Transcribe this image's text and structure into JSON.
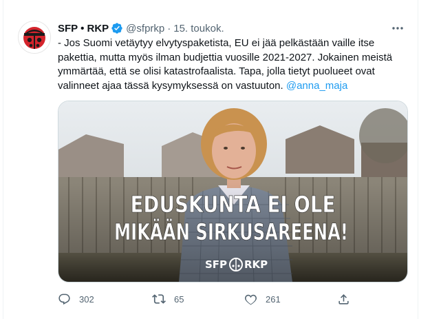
{
  "tweet": {
    "author_name": "SFP • RKP",
    "handle": "@sfprkp",
    "separator": "·",
    "date": "15. toukok.",
    "avatar_icon": "ladybug-logo-icon",
    "verified_icon": "verified-badge-icon",
    "more_icon": "more-dots-icon",
    "text_body": "- Jos Suomi vetäytyy elvytyspaketista, EU ei jää pelkästään vaille itse pakettia, mutta myös ilman budjettia vuosille 2021-2027. Jokainen meistä ymmärtää, että se olisi katastrofaalista. Tapa, jolla tietyt puolueet ovat valinneet ajaa tässä kysymyksessä on vastuuton.",
    "mention": "@anna_maja",
    "media": {
      "headline_line1": "EDUSKUNTA EI OLE",
      "headline_line2": "MIKÄÄN SIRKUSAREENA!",
      "logo_left": "SFP",
      "logo_right": "RKP"
    },
    "actions": {
      "reply_count": "302",
      "retweet_count": "65",
      "like_count": "261"
    }
  },
  "colors": {
    "accent": "#1d9bf0",
    "text": "#0f1419",
    "secondary": "#536471",
    "logo_red": "#d4242c",
    "headline_white": "#ffffff"
  }
}
